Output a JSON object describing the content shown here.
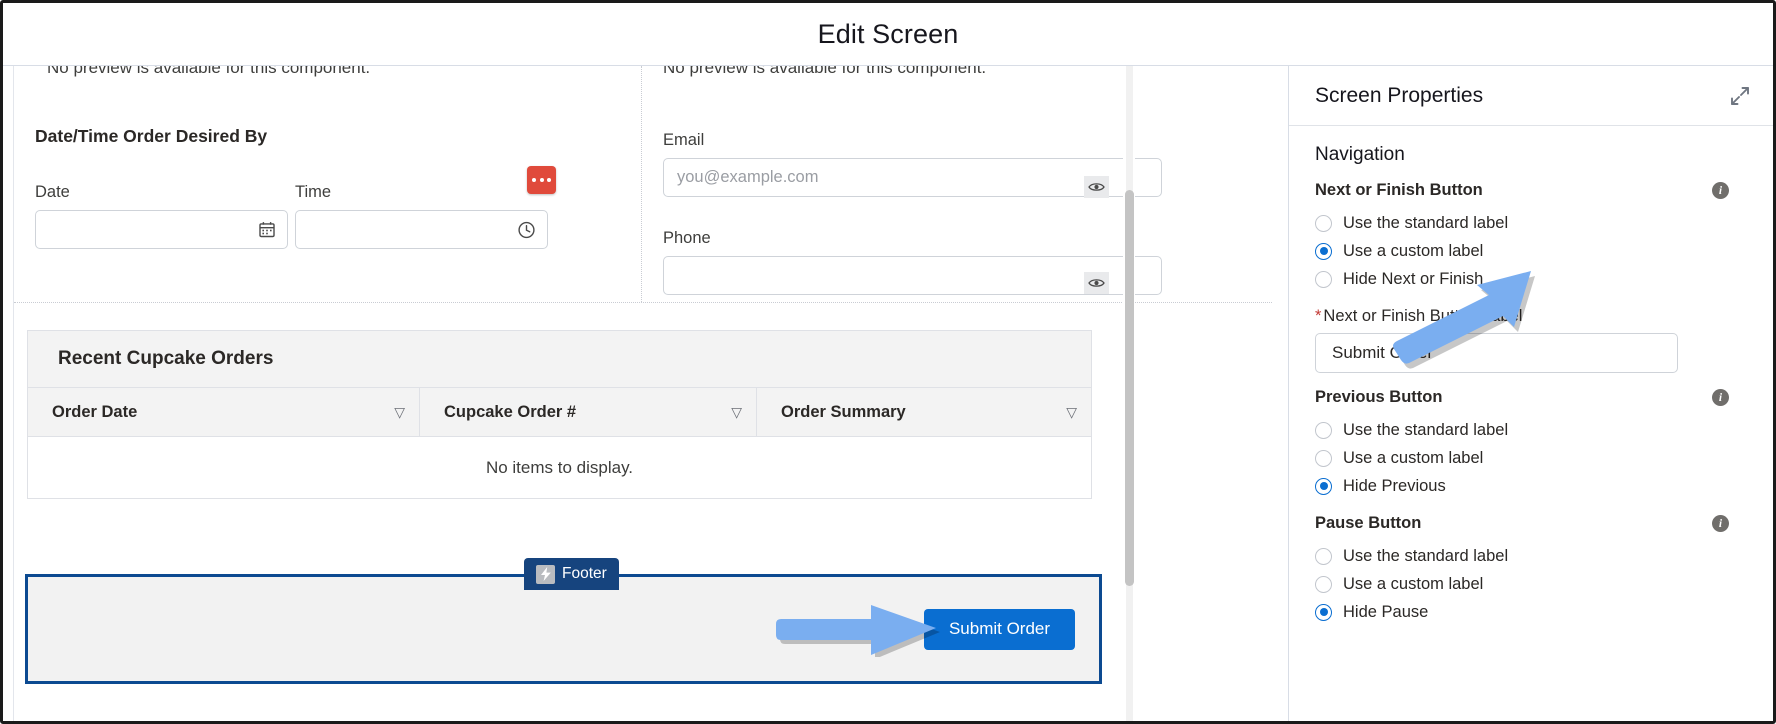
{
  "window": {
    "title": "Edit Screen"
  },
  "canvas": {
    "no_preview_left": "No preview is available for this component.",
    "no_preview_right": "No preview is available for this component.",
    "group_title": "Date/Time Order Desired By",
    "fields": {
      "date": {
        "label": "Date",
        "value": "",
        "icon": "calendar-icon"
      },
      "time": {
        "label": "Time",
        "value": "",
        "icon": "clock-icon"
      },
      "email": {
        "label": "Email",
        "value": "",
        "placeholder": "you@example.com"
      },
      "phone": {
        "label": "Phone",
        "value": "",
        "placeholder": ""
      }
    },
    "badges": {
      "more_actions": "more-actions-icon",
      "preview_eye": "eye-icon"
    },
    "table": {
      "title": "Recent Cupcake Orders",
      "columns": [
        "Order Date",
        "Cupcake Order #",
        "Order Summary"
      ],
      "empty_message": "No items to display.",
      "rows": []
    },
    "footer": {
      "badge_label": "Footer",
      "badge_icon": "lightning-bolt-icon",
      "submit_button": "Submit Order"
    }
  },
  "properties": {
    "header": "Screen Properties",
    "expand_icon": "expand-icon",
    "section": "Navigation",
    "groups": [
      {
        "name": "Next or Finish Button",
        "info_icon": "info-icon",
        "options": [
          {
            "label": "Use the standard label",
            "selected": false
          },
          {
            "label": "Use a custom label",
            "selected": true
          },
          {
            "label": "Hide Next or Finish",
            "selected": false
          }
        ],
        "field_label": "Next or Finish Button Label",
        "field_required": "*",
        "field_value": "Submit Order"
      },
      {
        "name": "Previous Button",
        "info_icon": "info-icon",
        "options": [
          {
            "label": "Use the standard label",
            "selected": false
          },
          {
            "label": "Use a custom label",
            "selected": false
          },
          {
            "label": "Hide Previous",
            "selected": true
          }
        ]
      },
      {
        "name": "Pause Button",
        "info_icon": "info-icon",
        "options": [
          {
            "label": "Use the standard label",
            "selected": false
          },
          {
            "label": "Use a custom label",
            "selected": false
          },
          {
            "label": "Hide Pause",
            "selected": true
          }
        ]
      }
    ]
  },
  "colors": {
    "accent_blue": "#0a6ed1",
    "selection_blue": "#0c4a91",
    "badge_navy": "#16447e",
    "alert_red": "#e04a3b",
    "required_red": "#c23934",
    "arrow_blue": "#7aaef0"
  }
}
